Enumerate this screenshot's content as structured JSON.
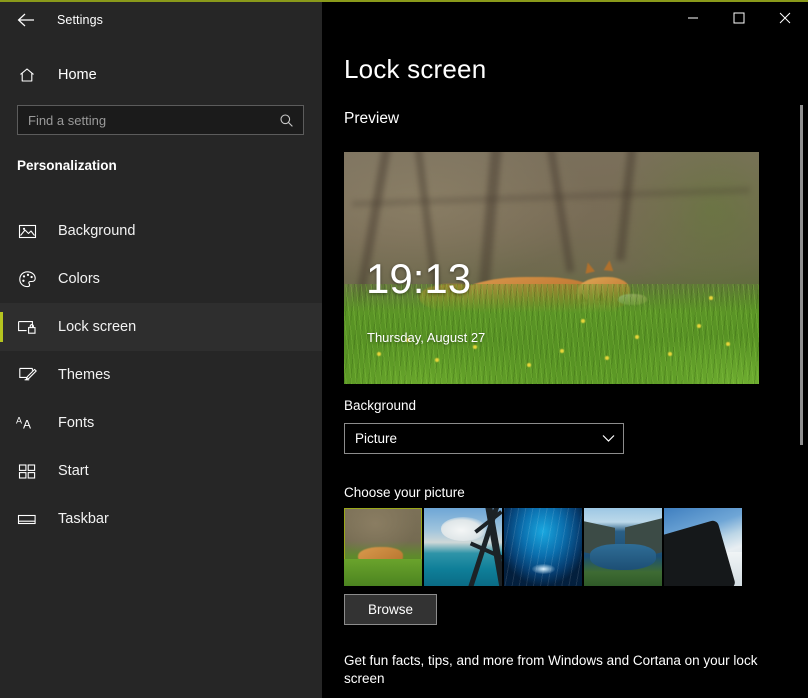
{
  "window": {
    "title": "Settings",
    "back_icon": "back-arrow-icon",
    "accent_color": "#b5c41f",
    "controls": {
      "minimize": "minimize-icon",
      "maximize": "maximize-icon",
      "close": "close-icon"
    }
  },
  "sidebar": {
    "home": {
      "label": "Home",
      "icon": "home-icon"
    },
    "search": {
      "placeholder": "Find a setting",
      "icon": "search-icon",
      "value": ""
    },
    "category": "Personalization",
    "items": [
      {
        "label": "Background",
        "icon": "image-icon",
        "selected": false
      },
      {
        "label": "Colors",
        "icon": "palette-icon",
        "selected": false
      },
      {
        "label": "Lock screen",
        "icon": "monitor-lock-icon",
        "selected": true
      },
      {
        "label": "Themes",
        "icon": "brush-icon",
        "selected": false
      },
      {
        "label": "Fonts",
        "icon": "font-aa-icon",
        "selected": false
      },
      {
        "label": "Start",
        "icon": "tiles-icon",
        "selected": false
      },
      {
        "label": "Taskbar",
        "icon": "taskbar-icon",
        "selected": false
      }
    ]
  },
  "main": {
    "page_title": "Lock screen",
    "preview_heading": "Preview",
    "preview": {
      "time": "19:13",
      "date": "Thursday, August 27",
      "image_description": "fox cubs running in green grass"
    },
    "background_setting": {
      "label": "Background",
      "selected_value": "Picture",
      "chevron_icon": "chevron-down-icon"
    },
    "choose_picture": {
      "label": "Choose your picture",
      "thumbnails": [
        {
          "name": "fox-in-grass",
          "selected": true
        },
        {
          "name": "ocean-structure-clouds",
          "selected": false
        },
        {
          "name": "blue-ice-cave",
          "selected": false
        },
        {
          "name": "mountain-lake-reflection",
          "selected": false
        },
        {
          "name": "dark-rock-snow-sky",
          "selected": false
        }
      ],
      "browse_label": "Browse"
    },
    "cortana_text": "Get fun facts, tips, and more from Windows and Cortana on your lock screen"
  }
}
